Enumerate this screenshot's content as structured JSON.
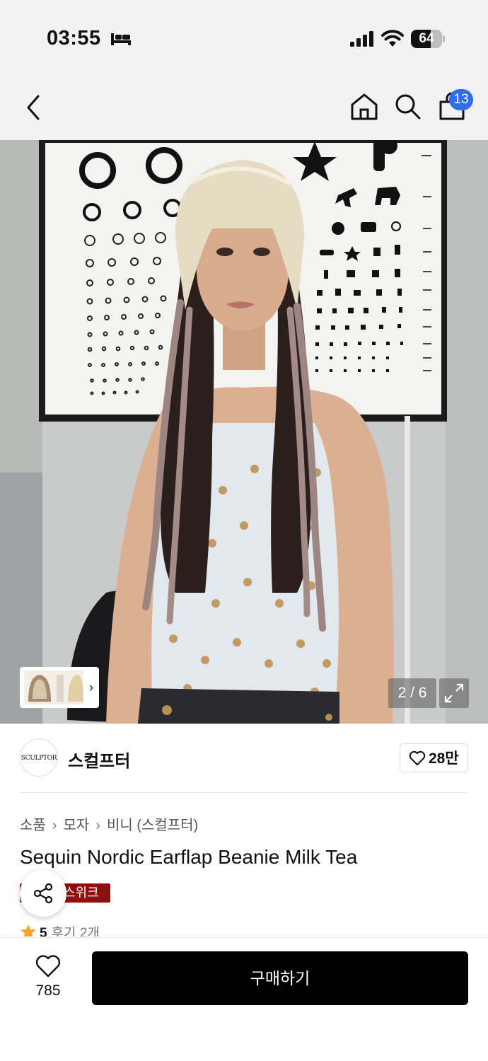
{
  "status": {
    "time": "03:55",
    "battery_level": "64",
    "icons": [
      "sleep-icon",
      "signal-icon",
      "wifi-icon",
      "battery-icon"
    ]
  },
  "nav": {
    "icons": [
      "back-icon",
      "home-icon",
      "search-icon",
      "shopping-bag-icon"
    ],
    "cart_count": "13"
  },
  "gallery": {
    "counter": "2 / 6",
    "thumb_chevron": "›",
    "icons": [
      "chevron-right-icon",
      "expand-icon"
    ]
  },
  "brand": {
    "logo_text": "SCULPTOR",
    "name": "스컬프터",
    "like_count": "28만"
  },
  "product": {
    "breadcrumb": [
      "소품",
      "모자",
      "비니 (스컬프터)"
    ],
    "breadcrumb_sep": "›",
    "title": "Sequin Nordic Earflap Beanie Milk Tea",
    "tag": "스위크",
    "rating": "5",
    "reviews": "후기 2개"
  },
  "bottom_bar": {
    "wish_count": "785",
    "buy_label": "구매하기"
  },
  "colors": {
    "badge_blue": "#2f6df6",
    "tag_red": "#8c1010",
    "star": "#f5a623",
    "buy_button": "#000000"
  }
}
